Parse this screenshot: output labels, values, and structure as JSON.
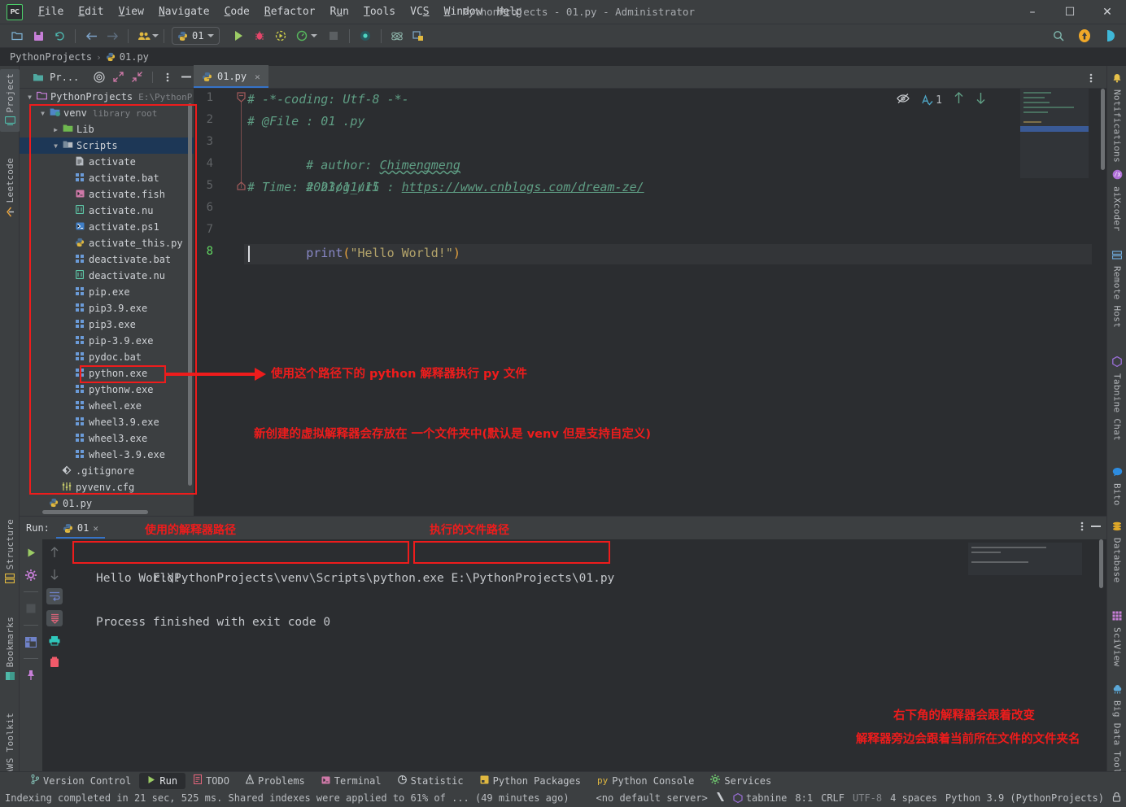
{
  "window": {
    "title": "PythonProjects - 01.py - Administrator",
    "logo": "PC",
    "minimize": "–",
    "maximize": "☐",
    "close": "✕"
  },
  "menu": {
    "items": [
      "File",
      "Edit",
      "View",
      "Navigate",
      "Code",
      "Refactor",
      "Run",
      "Tools",
      "VCS",
      "Window",
      "Help"
    ]
  },
  "toolbar": {
    "open_icon": "folder-icon",
    "save_icon": "save-icon",
    "sync_icon": "sync-icon",
    "back_icon": "back-arrow-icon",
    "forward_icon": "forward-arrow-icon",
    "users_icon": "users-icon",
    "run_config_label": "01",
    "run_icon": "run-icon",
    "debug_icon": "debug-icon",
    "run_coverage_icon": "run-coverage-icon",
    "profile_icon": "profile-icon",
    "stop_icon": "stop-icon",
    "record_icon": "record-icon",
    "atom_icon": "atom-icon",
    "layout_icon": "layout-icon",
    "search_icon": "search-icon",
    "update_icon": "update-badge-icon",
    "ai_icon": "ai-assistant-icon"
  },
  "breadcrumb": {
    "root": "PythonProjects",
    "separator": "›",
    "file": "01.py"
  },
  "left_rail": {
    "top": [
      {
        "label": "Project",
        "icon": "project-icon",
        "selected": true
      },
      {
        "label": "Leetcode",
        "icon": "leetcode-icon",
        "selected": false
      }
    ],
    "bottom": [
      {
        "label": "Structure",
        "icon": "structure-icon"
      },
      {
        "label": "Bookmarks",
        "icon": "bookmarks-icon"
      },
      {
        "label": "AWS Toolkit",
        "icon": "aws-icon"
      }
    ]
  },
  "right_rail": {
    "items": [
      {
        "label": "Notifications",
        "icon": "bell-icon"
      },
      {
        "label": "aiXcoder",
        "icon": "aixcoder-icon"
      },
      {
        "label": "Remote Host",
        "icon": "remote-host-icon"
      },
      {
        "label": "Tabnine Chat",
        "icon": "tabnine-icon"
      },
      {
        "label": "Bito",
        "icon": "bito-icon"
      },
      {
        "label": "Database",
        "icon": "database-icon"
      },
      {
        "label": "SciView",
        "icon": "sciview-icon"
      },
      {
        "label": "Big Data Tools",
        "icon": "bigdata-icon"
      }
    ]
  },
  "project_panel": {
    "title": "Pr...",
    "icons": [
      "folder-icon",
      "target-icon",
      "expand-icon",
      "collapse-icon",
      "more-icon",
      "hide-icon"
    ],
    "tree": [
      {
        "label": "PythonProjects",
        "sub": "E:\\PythonP",
        "depth": 0,
        "icon": "folder-icon",
        "arrow": "down",
        "selected": false
      },
      {
        "label": "venv",
        "sub": "library root",
        "depth": 1,
        "icon": "venv-icon",
        "arrow": "down",
        "selected": false
      },
      {
        "label": "Lib",
        "sub": "",
        "depth": 2,
        "icon": "lib-folder-icon",
        "arrow": "right",
        "selected": false
      },
      {
        "label": "Scripts",
        "sub": "",
        "depth": 2,
        "icon": "scripts-folder-icon",
        "arrow": "down",
        "selected": true
      },
      {
        "label": "activate",
        "sub": "",
        "depth": 3,
        "icon": "file-icon",
        "arrow": "",
        "selected": false
      },
      {
        "label": "activate.bat",
        "sub": "",
        "depth": 3,
        "icon": "windows-icon",
        "arrow": "",
        "selected": false
      },
      {
        "label": "activate.fish",
        "sub": "",
        "depth": 3,
        "icon": "shell-icon",
        "arrow": "",
        "selected": false
      },
      {
        "label": "activate.nu",
        "sub": "",
        "depth": 3,
        "icon": "nu-icon",
        "arrow": "",
        "selected": false
      },
      {
        "label": "activate.ps1",
        "sub": "",
        "depth": 3,
        "icon": "powershell-icon",
        "arrow": "",
        "selected": false
      },
      {
        "label": "activate_this.py",
        "sub": "",
        "depth": 3,
        "icon": "python-icon",
        "arrow": "",
        "selected": false
      },
      {
        "label": "deactivate.bat",
        "sub": "",
        "depth": 3,
        "icon": "windows-icon",
        "arrow": "",
        "selected": false
      },
      {
        "label": "deactivate.nu",
        "sub": "",
        "depth": 3,
        "icon": "nu-icon",
        "arrow": "",
        "selected": false
      },
      {
        "label": "pip.exe",
        "sub": "",
        "depth": 3,
        "icon": "windows-icon",
        "arrow": "",
        "selected": false
      },
      {
        "label": "pip3.9.exe",
        "sub": "",
        "depth": 3,
        "icon": "windows-icon",
        "arrow": "",
        "selected": false
      },
      {
        "label": "pip3.exe",
        "sub": "",
        "depth": 3,
        "icon": "windows-icon",
        "arrow": "",
        "selected": false
      },
      {
        "label": "pip-3.9.exe",
        "sub": "",
        "depth": 3,
        "icon": "windows-icon",
        "arrow": "",
        "selected": false
      },
      {
        "label": "pydoc.bat",
        "sub": "",
        "depth": 3,
        "icon": "windows-icon",
        "arrow": "",
        "selected": false
      },
      {
        "label": "python.exe",
        "sub": "",
        "depth": 3,
        "icon": "windows-icon",
        "arrow": "",
        "selected": false,
        "highlighted": true
      },
      {
        "label": "pythonw.exe",
        "sub": "",
        "depth": 3,
        "icon": "windows-icon",
        "arrow": "",
        "selected": false
      },
      {
        "label": "wheel.exe",
        "sub": "",
        "depth": 3,
        "icon": "windows-icon",
        "arrow": "",
        "selected": false
      },
      {
        "label": "wheel3.9.exe",
        "sub": "",
        "depth": 3,
        "icon": "windows-icon",
        "arrow": "",
        "selected": false
      },
      {
        "label": "wheel3.exe",
        "sub": "",
        "depth": 3,
        "icon": "windows-icon",
        "arrow": "",
        "selected": false
      },
      {
        "label": "wheel-3.9.exe",
        "sub": "",
        "depth": 3,
        "icon": "windows-icon",
        "arrow": "",
        "selected": false
      },
      {
        "label": ".gitignore",
        "sub": "",
        "depth": 2,
        "icon": "git-icon",
        "arrow": "",
        "selected": false
      },
      {
        "label": "pyvenv.cfg",
        "sub": "",
        "depth": 2,
        "icon": "config-icon",
        "arrow": "",
        "selected": false
      },
      {
        "label": "01.py",
        "sub": "",
        "depth": 1,
        "icon": "python-icon",
        "arrow": "",
        "selected": false
      }
    ]
  },
  "editor": {
    "tab_label": "01.py",
    "tab_icon": "python-icon",
    "close_icon": "close-icon",
    "inspection_count": "1",
    "right_icons": [
      "hide-inspections-icon",
      "inspections-icon",
      "prev-problem-icon",
      "next-problem-icon"
    ],
    "lines": [
      {
        "no": "1",
        "text": "# -*-coding: Utf-8 -*-"
      },
      {
        "no": "2",
        "text": "# @File : 01 .py"
      },
      {
        "no": "3",
        "text": "# author: Chimengmeng"
      },
      {
        "no": "4",
        "text": "# blog_url : https://www.cnblogs.com/dream-ze/"
      },
      {
        "no": "5",
        "text": "# Time: 2023/11/15"
      },
      {
        "no": "6",
        "text": ""
      },
      {
        "no": "7",
        "text": "print(\"Hello World!\")"
      },
      {
        "no": "8",
        "text": ""
      }
    ],
    "code_parts": {
      "l3_prefix": "# author: ",
      "l3_wavy": "Chimengmeng",
      "l4_prefix": "# blog_url : ",
      "l4_link": "https://www.cnblogs.com/dream-ze/",
      "l7_fn": "print",
      "l7_open": "(",
      "l7_str": "\"Hello World!\"",
      "l7_close": ")"
    },
    "current_line": "8"
  },
  "annotations": {
    "interpreter_path_note": "使用这个路径下的 python 解释器执行 py 文件",
    "venv_note": "新创建的虚拟解释器会存放在 一个文件夹中(默认是 venv 但是支持自定义)",
    "used_interpreter_label": "使用的解释器路径",
    "executed_file_label": "执行的文件路径",
    "bottom_right_1": "右下角的解释器会跟着改变",
    "bottom_right_2": "解释器旁边会跟着当前所在文件的文件夹名",
    "color": "#ee1c1c"
  },
  "run_panel": {
    "label": "Run:",
    "tab_label": "01",
    "tab_icon": "python-icon",
    "close_icon": "close-icon",
    "more_icon": "more-icon",
    "hide_icon": "hide-icon",
    "side_icons": [
      "rerun-icon",
      "settings-icon",
      "stop-icon",
      "layout-icon",
      "pin-icon"
    ],
    "side_icons2": [
      "up-arrow-icon",
      "down-arrow-icon",
      "soft-wrap-icon",
      "scroll-end-icon",
      "print-icon",
      "clear-icon"
    ],
    "output": {
      "interpreter_path": "E:\\PythonProjects\\venv\\Scripts\\python.exe",
      "script_path": "E:\\PythonProjects\\01.py",
      "stdout": "Hello World!",
      "exit_message": "Process finished with exit code 0"
    }
  },
  "bottom_tabs": [
    {
      "label": "Version Control",
      "icon": "branch-icon",
      "selected": false
    },
    {
      "label": "Run",
      "icon": "run-icon",
      "selected": true
    },
    {
      "label": "TODO",
      "icon": "todo-icon",
      "selected": false
    },
    {
      "label": "Problems",
      "icon": "problems-icon",
      "selected": false
    },
    {
      "label": "Terminal",
      "icon": "terminal-icon",
      "selected": false
    },
    {
      "label": "Statistic",
      "icon": "statistic-icon",
      "selected": false
    },
    {
      "label": "Python Packages",
      "icon": "packages-icon",
      "selected": false
    },
    {
      "label": "Python Console",
      "icon": "python-console-icon",
      "selected": false
    },
    {
      "label": "Services",
      "icon": "services-icon",
      "selected": false
    }
  ],
  "statusbar": {
    "message": "Indexing completed in 21 sec, 525 ms. Shared indexes were applied to 61% of ... (49 minutes ago)",
    "server": "<no default server>",
    "vcs_icon": "vcs-icon",
    "tabnine": "tabnine",
    "caret_position": "8:1",
    "line_separator": "CRLF",
    "encoding": "UTF-8",
    "indent": "4 spaces",
    "interpreter": "Python 3.9 (PythonProjects)",
    "lock_icon": "lock-icon"
  }
}
